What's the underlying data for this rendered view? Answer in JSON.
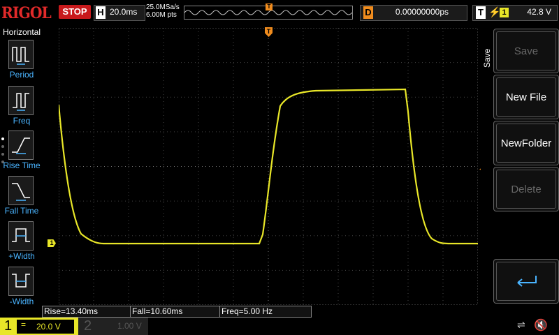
{
  "top": {
    "logo": "RIGOL",
    "run_state": "STOP",
    "horizontal_label": "H",
    "timebase": "20.0ms",
    "sample_rate": "25.0MSa/s",
    "memory_depth": "6.00M pts",
    "trigger_pos_label": "T",
    "delay_label": "D",
    "delay_value": "0.00000000ps",
    "trigger_label": "T",
    "trigger_source": "1",
    "trigger_level": "42.8 V"
  },
  "left_menu": {
    "title": "Horizontal",
    "items": [
      {
        "label": "Period",
        "icon": "period-icon"
      },
      {
        "label": "Freq",
        "icon": "freq-icon"
      },
      {
        "label": "Rise Time",
        "icon": "rise-time-icon"
      },
      {
        "label": "Fall Time",
        "icon": "fall-time-icon"
      },
      {
        "label": "+Width",
        "icon": "positive-width-icon"
      },
      {
        "label": "-Width",
        "icon": "negative-width-icon"
      }
    ]
  },
  "right_menu": {
    "title": "Save",
    "buttons": [
      {
        "label": "Save",
        "enabled": false
      },
      {
        "label": "New File",
        "enabled": true
      },
      {
        "label": "NewFolder",
        "enabled": true
      },
      {
        "label": "Delete",
        "enabled": false
      },
      {
        "label": "",
        "icon": "return-arrow-icon",
        "enabled": true
      }
    ]
  },
  "measurements": {
    "rise": "Rise=13.40ms",
    "fall": "Fall=10.60ms",
    "freq": "Freq=5.00 Hz"
  },
  "markers": {
    "channel1": "1",
    "trigger": "T"
  },
  "channels": [
    {
      "number": "1",
      "coupling": "=",
      "scale": "20.0 V",
      "active": true
    },
    {
      "number": "2",
      "scale": "1.00 V",
      "active": false
    }
  ],
  "colors": {
    "ch1": "#e8e628",
    "accent": "#f08c1e",
    "stop": "#c8191c",
    "grid": "#5a5a5a",
    "menu_label": "#4ab4ff"
  }
}
